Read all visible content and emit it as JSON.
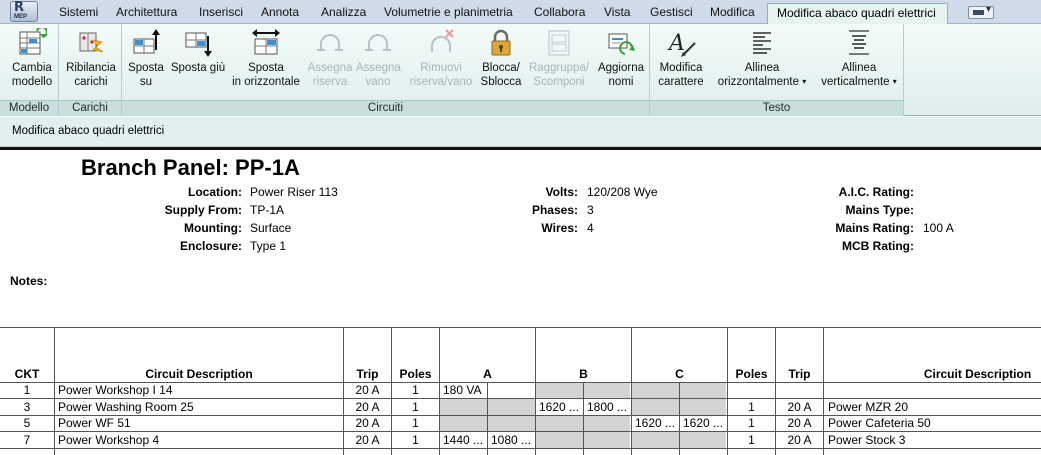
{
  "app": {
    "badge": "MEP",
    "logo_letter": "R"
  },
  "menu": {
    "tabs": [
      "Sistemi",
      "Architettura",
      "Inserisci",
      "Annota",
      "Analizza",
      "Volumetrie e planimetria",
      "Collabora",
      "Vista",
      "Gestisci",
      "Modifica"
    ],
    "active_tab": "Modifica abaco quadri elettrici"
  },
  "ribbon": {
    "panels": {
      "modello": "Modello",
      "carichi": "Carichi",
      "circuiti": "Circuiti",
      "testo": "Testo"
    },
    "buttons": {
      "cambia_1": "Cambia",
      "cambia_2": "modello",
      "ribilancia_1": "Ribilancia",
      "ribilancia_2": "carichi",
      "sposta_su_1": "Sposta",
      "sposta_su_2": "su",
      "sposta_giu": "Sposta giù",
      "sposta_orizz_1": "Sposta",
      "sposta_orizz_2": "in orizzontale",
      "assegna_riserva_1": "Assegna",
      "assegna_riserva_2": "riserva",
      "assegna_vano_1": "Assegna",
      "assegna_vano_2": "vano",
      "rimuovi_1": "Rimuovi",
      "rimuovi_2": "riserva/vano",
      "blocca_1": "Blocca/",
      "blocca_2": "Sblocca",
      "raggruppa_1": "Raggruppa/",
      "raggruppa_2": "Scomponi",
      "aggiorna_1": "Aggiorna",
      "aggiorna_2": "nomi",
      "modifica_car_1": "Modifica",
      "modifica_car_2": "carattere",
      "allinea_o_1": "Allinea",
      "allinea_o_2": "orizzontalmente",
      "allinea_v_1": "Allinea",
      "allinea_v_2": "verticalmente"
    }
  },
  "context_bar": "Modifica abaco quadri elettrici",
  "panel": {
    "title": "Branch Panel: PP-1A",
    "fields_left": [
      {
        "label": "Location:",
        "value": "Power Riser 113"
      },
      {
        "label": "Supply From:",
        "value": "TP-1A"
      },
      {
        "label": "Mounting:",
        "value": "Surface"
      },
      {
        "label": "Enclosure:",
        "value": "Type 1"
      }
    ],
    "fields_mid": [
      {
        "label": "Volts:",
        "value": "120/208 Wye"
      },
      {
        "label": "Phases:",
        "value": "3"
      },
      {
        "label": "Wires:",
        "value": "4"
      }
    ],
    "fields_right": [
      {
        "label": "A.I.C. Rating:",
        "value": ""
      },
      {
        "label": "Mains Type:",
        "value": ""
      },
      {
        "label": "Mains Rating:",
        "value": "100 A"
      },
      {
        "label": "MCB Rating:",
        "value": ""
      }
    ],
    "notes_label": "Notes:"
  },
  "schedule": {
    "headers": {
      "ckt": "CKT",
      "desc_left": "Circuit Description",
      "trip_left": "Trip",
      "poles_left": "Poles",
      "phase_a": "A",
      "phase_b": "B",
      "phase_c": "C",
      "poles_right": "Poles",
      "trip_right": "Trip",
      "desc_right": "Circuit Description"
    },
    "rows": [
      {
        "ckt": "1",
        "desc": "Power Workshop I 14",
        "trip": "20 A",
        "poles": "1",
        "a1": "180 VA",
        "a2": "",
        "b1": "",
        "b2": "",
        "c1": "",
        "c2": "",
        "poles_r": "",
        "trip_r": "",
        "desc_r": ""
      },
      {
        "ckt": "3",
        "desc": "Power Washing Room 25",
        "trip": "20 A",
        "poles": "1",
        "a1": "",
        "a2": "",
        "b1": "1620 ...",
        "b2": "1800 ...",
        "c1": "",
        "c2": "",
        "poles_r": "1",
        "trip_r": "20 A",
        "desc_r": "Power MZR 20"
      },
      {
        "ckt": "5",
        "desc": "Power WF 51",
        "trip": "20 A",
        "poles": "1",
        "a1": "",
        "a2": "",
        "b1": "",
        "b2": "",
        "c1": "1620 ...",
        "c2": "1620 ...",
        "poles_r": "1",
        "trip_r": "20 A",
        "desc_r": "Power Cafeteria 50"
      },
      {
        "ckt": "7",
        "desc": "Power Workshop 4",
        "trip": "20 A",
        "poles": "1",
        "a1": "1440 ...",
        "a2": "1080 ...",
        "b1": "",
        "b2": "",
        "c1": "",
        "c2": "",
        "poles_r": "1",
        "trip_r": "20 A",
        "desc_r": "Power Stock 3"
      }
    ]
  },
  "colors": {
    "ribbon": "#e6f3f1",
    "menubar": "#cfdbe8",
    "cell_gray": "#d4d4d4"
  },
  "icons": [
    "change-model-icon",
    "rebalance-icon",
    "move-up-icon",
    "move-down-icon",
    "move-horizontal-icon",
    "assign-spare-icon",
    "assign-space-icon",
    "remove-spare-icon",
    "lock-icon",
    "group-icon",
    "update-names-icon",
    "font-icon",
    "align-horizontal-icon",
    "align-vertical-icon"
  ]
}
